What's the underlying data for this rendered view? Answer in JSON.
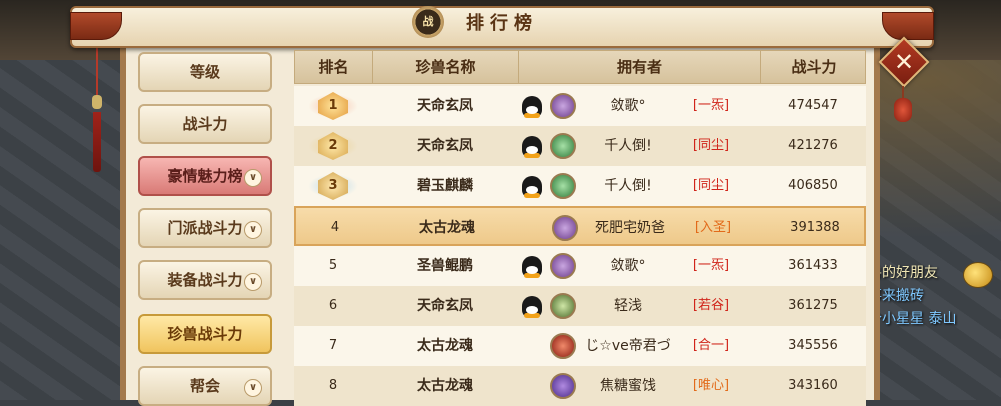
{
  "title": "排行榜",
  "title_emblem": "战",
  "close_label": "✕",
  "sidebar": {
    "items": [
      {
        "label": "等级",
        "style": "normal",
        "chevron": false
      },
      {
        "label": "战斗力",
        "style": "normal",
        "chevron": false
      },
      {
        "label": "豪情魅力榜",
        "style": "pink",
        "chevron": true
      },
      {
        "label": "门派战斗力",
        "style": "normal",
        "chevron": true
      },
      {
        "label": "装备战斗力",
        "style": "normal",
        "chevron": true
      },
      {
        "label": "珍兽战斗力",
        "style": "gold",
        "chevron": false
      },
      {
        "label": "帮会",
        "style": "normal",
        "chevron": true
      }
    ]
  },
  "table": {
    "headers": [
      "排名",
      "珍兽名称",
      "拥有者",
      "战斗力"
    ],
    "rows": [
      {
        "rank": "1",
        "medal": true,
        "pet_name": "天命玄凤",
        "qq": true,
        "pet_icon": "purple",
        "owner": "敛歌°",
        "guild": "[一炁]",
        "guild_color": "red",
        "power": "474547"
      },
      {
        "rank": "2",
        "medal": true,
        "pet_name": "天命玄凤",
        "qq": true,
        "pet_icon": "green",
        "owner": "千人倒!",
        "guild": "[同尘]",
        "guild_color": "red",
        "power": "421276"
      },
      {
        "rank": "3",
        "medal": true,
        "pet_name": "碧玉麒麟",
        "qq": true,
        "pet_icon": "green",
        "owner": "千人倒!",
        "guild": "[同尘]",
        "guild_color": "red",
        "power": "406850"
      },
      {
        "rank": "4",
        "medal": false,
        "pet_name": "太古龙魂",
        "qq": false,
        "pet_icon": "purple",
        "owner": "死肥宅奶爸",
        "guild": "[入圣]",
        "guild_color": "orange",
        "power": "391388",
        "selected": true
      },
      {
        "rank": "5",
        "medal": false,
        "pet_name": "圣兽鲲鹏",
        "qq": true,
        "pet_icon": "purple",
        "owner": "敛歌°",
        "guild": "[一炁]",
        "guild_color": "red",
        "power": "361433"
      },
      {
        "rank": "6",
        "medal": false,
        "pet_name": "天命玄凤",
        "qq": true,
        "pet_icon": "greenface",
        "owner": "轻浅",
        "guild": "[若谷]",
        "guild_color": "red",
        "power": "361275"
      },
      {
        "rank": "7",
        "medal": false,
        "pet_name": "太古龙魂",
        "qq": false,
        "pet_icon": "red",
        "owner": "じ☆ve帝君づ",
        "guild": "[合一]",
        "guild_color": "red",
        "power": "345556"
      },
      {
        "rank": "8",
        "medal": false,
        "pet_name": "太古龙魂",
        "qq": false,
        "pet_icon": "violet",
        "owner": "焦糖蜜饯",
        "guild": "[唯心]",
        "guild_color": "orange",
        "power": "343160"
      }
    ]
  },
  "chat": {
    "lines": [
      "兽的好朋友",
      "事来搬砖",
      "个小星星"
    ],
    "extra": "泰山"
  }
}
